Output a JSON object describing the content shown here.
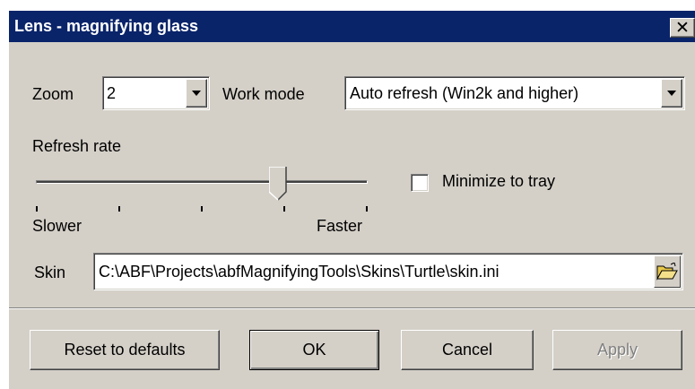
{
  "window": {
    "title": "Lens - magnifying glass",
    "close_glyph": "✕"
  },
  "zoom": {
    "label": "Zoom",
    "value": "2"
  },
  "work_mode": {
    "label": "Work mode",
    "value": "Auto refresh (Win2k and higher)"
  },
  "refresh": {
    "label": "Refresh rate",
    "min_label": "Slower",
    "max_label": "Faster",
    "position_fraction": 0.73,
    "tick_count": 5
  },
  "minimize": {
    "label": "Minimize to tray",
    "checked": false
  },
  "skin": {
    "label": "Skin",
    "value": "C:\\ABF\\Projects\\abfMagnifyingTools\\Skins\\Turtle\\skin.ini",
    "browse_icon": "folder-open-icon"
  },
  "buttons": {
    "reset": "Reset to defaults",
    "ok": "OK",
    "cancel": "Cancel",
    "apply": "Apply"
  },
  "colors": {
    "titlebar": "#0a246a",
    "face": "#d4d0c8",
    "folder": "#e8c84a"
  }
}
